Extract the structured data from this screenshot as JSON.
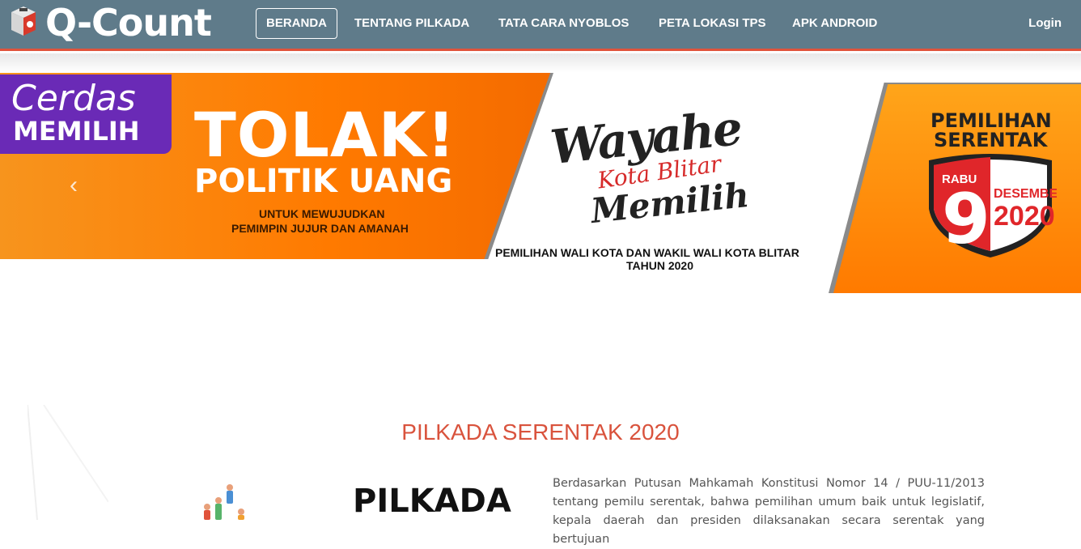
{
  "navbar": {
    "brand": "Q-Count",
    "items": [
      {
        "label": "BERANDA",
        "active": true
      },
      {
        "label": "TENTANG PILKADA"
      },
      {
        "label": "TATA CARA NYOBLOS"
      },
      {
        "label": "PETA LOKASI TPS"
      },
      {
        "label": "APK ANDROID"
      }
    ],
    "login": "Login"
  },
  "banner": {
    "cerdas": "Cerdas",
    "memilih": "MEMILIH",
    "tolak": "TOLAK!",
    "politik": "POLITIK UANG",
    "untuk_line1": "UNTUK MEWUJUDKAN",
    "untuk_line2": "PEMIMPIN JUJUR DAN AMANAH",
    "wayahe": "Wayahe",
    "kota_blitar": "Kota Blitar",
    "memilih_script": "Memilih",
    "pemilihan_line1": "PEMILIHAN WALI KOTA DAN WAKIL WALI KOTA BLITAR",
    "pemilihan_line2": "TAHUN 2020",
    "serentak_line1": "PEMILIHAN",
    "serentak_line2": "SERENTAK",
    "rabu": "RABU",
    "day": "9",
    "desember": "DESEMBER",
    "year": "2020",
    "prev_arrow": "‹"
  },
  "section": {
    "title": "PILKADA SERENTAK 2020",
    "thumb_title": "PILKADA",
    "paragraph": "Berdasarkan Putusan Mahkamah Konstitusi Nomor 14 / PUU-11/2013 tentang pemilu serentak, bahwa pemilihan umum baik untuk legislatif, kepala daerah dan presiden dilaksanakan secara serentak yang bertujuan"
  },
  "colors": {
    "navbar": "#5f7b8a",
    "accent": "#e0533b",
    "title": "#d9533d"
  }
}
